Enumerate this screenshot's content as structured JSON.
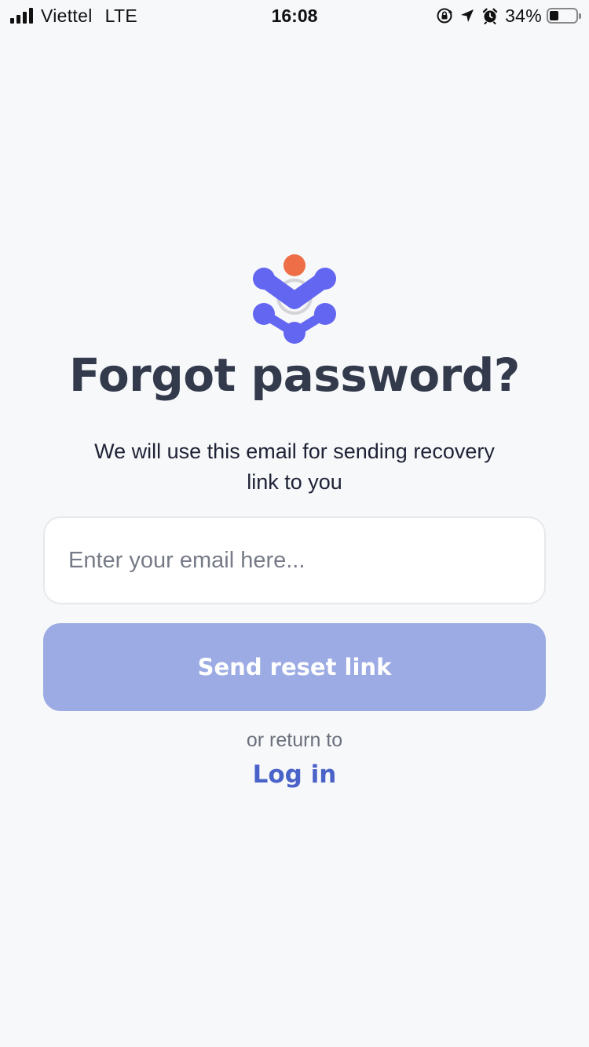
{
  "status_bar": {
    "carrier": "Viettel",
    "network": "LTE",
    "time": "16:08",
    "battery_percent_label": "34%",
    "battery_level": 0.34,
    "icons": [
      "signal-icon",
      "orientation-lock-icon",
      "location-arrow-icon",
      "alarm-clock-icon",
      "battery-icon"
    ]
  },
  "brand": {
    "logo_icon": "brand-logo-icon",
    "primary_color": "#6366f1",
    "accent_color": "#ee6e47"
  },
  "forgot": {
    "title": "Forgot password?",
    "subtitle": "We will use this email for sending recovery link to you",
    "email_value": "",
    "email_placeholder": "Enter your email here...",
    "send_button_label": "Send reset link",
    "send_button_color": "#9cabe3",
    "return_text": "or return to",
    "login_link_label": "Log in",
    "login_link_color": "#4a63c8"
  }
}
